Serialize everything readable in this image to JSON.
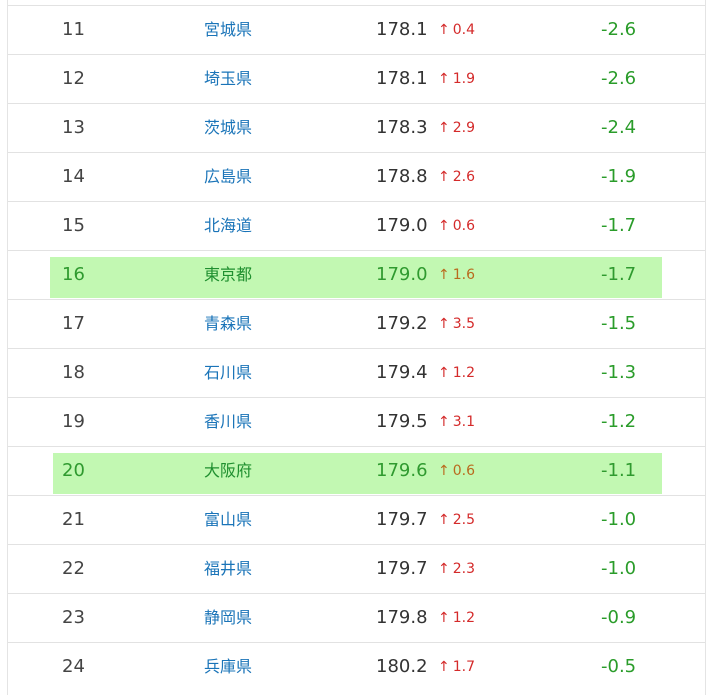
{
  "table": {
    "rows": [
      {
        "rank": "11",
        "prefecture": "宮城県",
        "height": "178.1",
        "change": "0.4",
        "diff": "-2.6",
        "highlight": false
      },
      {
        "rank": "12",
        "prefecture": "埼玉県",
        "height": "178.1",
        "change": "1.9",
        "diff": "-2.6",
        "highlight": false
      },
      {
        "rank": "13",
        "prefecture": "茨城県",
        "height": "178.3",
        "change": "2.9",
        "diff": "-2.4",
        "highlight": false
      },
      {
        "rank": "14",
        "prefecture": "広島県",
        "height": "178.8",
        "change": "2.6",
        "diff": "-1.9",
        "highlight": false
      },
      {
        "rank": "15",
        "prefecture": "北海道",
        "height": "179.0",
        "change": "0.6",
        "diff": "-1.7",
        "highlight": false
      },
      {
        "rank": "16",
        "prefecture": "東京都",
        "height": "179.0",
        "change": "1.6",
        "diff": "-1.7",
        "highlight": true
      },
      {
        "rank": "17",
        "prefecture": "青森県",
        "height": "179.2",
        "change": "3.5",
        "diff": "-1.5",
        "highlight": false
      },
      {
        "rank": "18",
        "prefecture": "石川県",
        "height": "179.4",
        "change": "1.2",
        "diff": "-1.3",
        "highlight": false
      },
      {
        "rank": "19",
        "prefecture": "香川県",
        "height": "179.5",
        "change": "3.1",
        "diff": "-1.2",
        "highlight": false
      },
      {
        "rank": "20",
        "prefecture": "大阪府",
        "height": "179.6",
        "change": "0.6",
        "diff": "-1.1",
        "highlight": true
      },
      {
        "rank": "21",
        "prefecture": "富山県",
        "height": "179.7",
        "change": "2.5",
        "diff": "-1.0",
        "highlight": false
      },
      {
        "rank": "22",
        "prefecture": "福井県",
        "height": "179.7",
        "change": "2.3",
        "diff": "-1.0",
        "highlight": false
      },
      {
        "rank": "23",
        "prefecture": "静岡県",
        "height": "179.8",
        "change": "1.2",
        "diff": "-0.9",
        "highlight": false
      },
      {
        "rank": "24",
        "prefecture": "兵庫県",
        "height": "180.2",
        "change": "1.7",
        "diff": "-0.5",
        "highlight": false
      }
    ]
  },
  "icons": {
    "change_arrow": "arrow-up-icon"
  },
  "colors": {
    "link": "#1a74b8",
    "increase": "#d42a2a",
    "diff": "#2a9c2a",
    "highlight_bg": "#c2f8b2",
    "divider": "#e2e2e2"
  }
}
